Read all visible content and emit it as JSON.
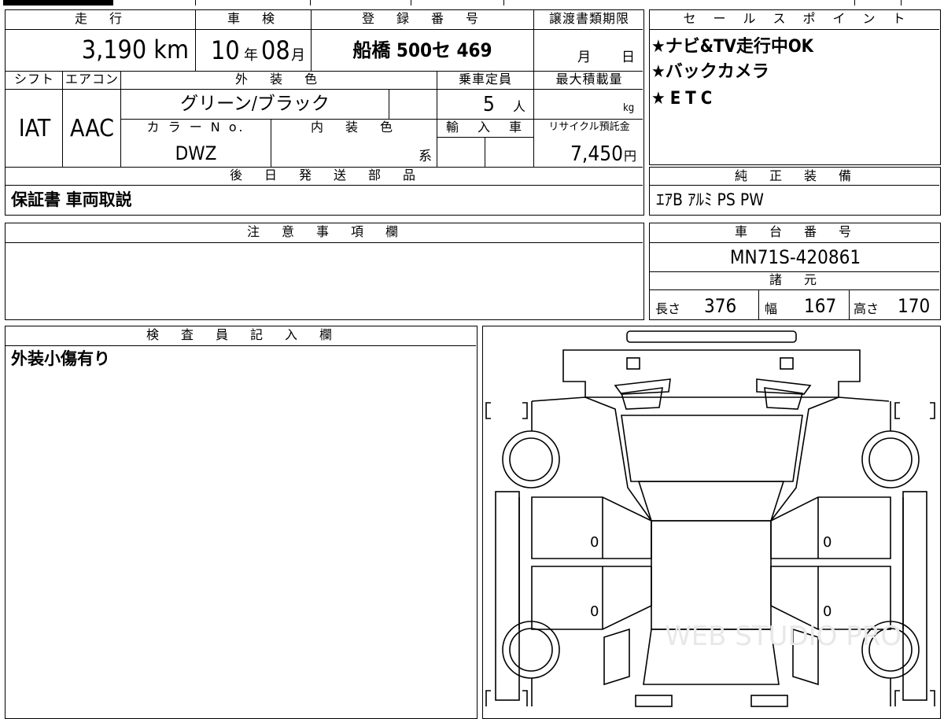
{
  "top": {
    "mileage_label": "走　行",
    "mileage_value": "3,190 km",
    "inspection_label": "車　検",
    "inspection_year": "10",
    "inspection_year_unit": "年",
    "inspection_month": "08",
    "inspection_month_unit": "月",
    "registration_label": "登　録　番　号",
    "registration_value": "船橋 500セ 469",
    "transfer_deadline_label": "譲渡書類期限",
    "transfer_month_unit": "月",
    "transfer_day_unit": "日"
  },
  "row2": {
    "shift_label": "シフト",
    "shift_value": "IAT",
    "ac_label": "エアコン",
    "ac_value": "AAC",
    "exterior_color_label": "外　装　色",
    "exterior_color_value": "グリーン/ブラック",
    "capacity_label": "乗車定員",
    "capacity_value": "5",
    "capacity_unit": "人",
    "max_load_label": "最大積載量",
    "max_load_unit": "kg",
    "color_no_label": "カ ラ ー N o.",
    "color_no_value": "DWZ",
    "interior_color_label": "内　装　色",
    "interior_suffix": "系",
    "import_label": "輸　入　車",
    "recycle_label": "リサイクル預託金",
    "recycle_value": "7,450",
    "recycle_unit": "円"
  },
  "later_parts": {
    "label": "後　日　発　送　部　品",
    "value": "保証書 車両取説"
  },
  "notes": {
    "label": "注　意　事　項　欄"
  },
  "inspector": {
    "label": "検　査　員　記　入　欄",
    "value": "外装小傷有り"
  },
  "sales_points": {
    "label": "セ　ー　ル　ス　ポ　イ　ン　ト",
    "items": [
      "★ナビ&TV走行中OK",
      "★バックカメラ",
      "★ETC"
    ]
  },
  "equipment": {
    "label": "純　正　装　備",
    "value": "ｴｱB ｱﾙﾐ PS PW"
  },
  "chassis": {
    "label": "車　台　番　号",
    "value": "MN71S-420861"
  },
  "specs": {
    "label": "諸　元",
    "length_label": "長さ",
    "length_value": "376",
    "width_label": "幅",
    "width_value": "167",
    "height_label": "高さ",
    "height_value": "170"
  },
  "diagram": {
    "mark_left_upper": "0",
    "mark_left_lower": "0",
    "mark_right_upper": "0",
    "mark_right_lower": "0",
    "watermark": "WEB STUDIO PRO"
  }
}
